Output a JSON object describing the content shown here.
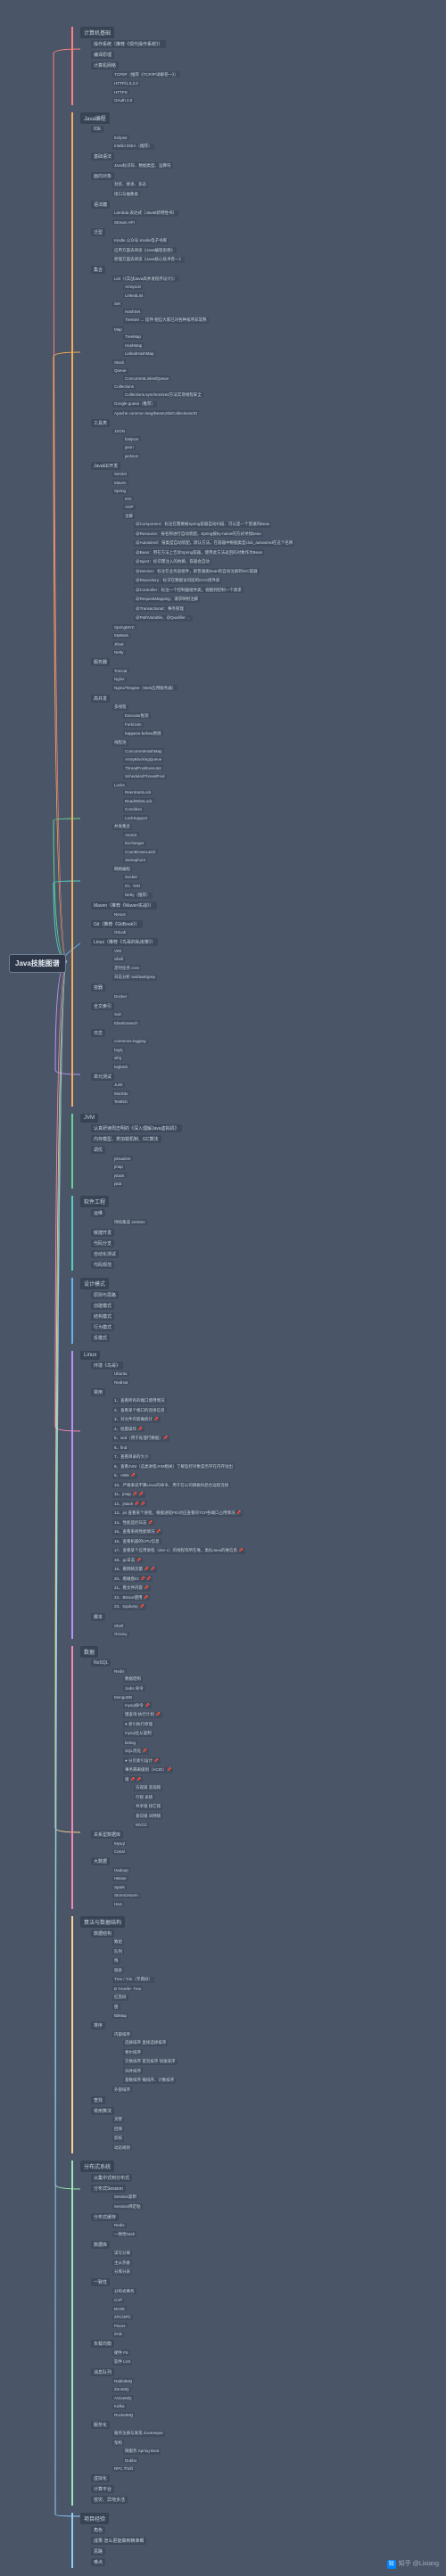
{
  "root": "Java技能图谱",
  "watermark": "知乎 @Lixiang",
  "branches": [
    {
      "title": "计算机基础",
      "color": "c1",
      "children": [
        {
          "label": "操作系统（推荐《现代操作系统》）"
        },
        {
          "label": "编译原理"
        },
        {
          "label": "计算机网络",
          "children": [
            {
              "label": "TCP/IP（推荐《TCP/IP详解卷一》）"
            },
            {
              "label": "HTTP/1.0,2.0"
            },
            {
              "label": "HTTPS"
            },
            {
              "label": "OAuth 2.0"
            }
          ]
        }
      ]
    },
    {
      "title": "Java编程",
      "color": "c2",
      "children": [
        {
          "label": "IDE",
          "children": [
            {
              "label": "Eclipse"
            },
            {
              "label": "IntelliJ IDEA（推荐）"
            }
          ]
        },
        {
          "label": "基础语法",
          "children": [
            {
              "label": "Java标识符、数据类型、运算符"
            }
          ]
        },
        {
          "label": "面向对象",
          "children": [
            {
              "label": "封装、继承、多态"
            },
            {
              "label": "接口与抽象类"
            }
          ]
        },
        {
          "label": "语法糖",
          "children": [
            {
              "label": "Lambda 表达式（Java8新特性书）"
            },
            {
              "label": "Stream API"
            }
          ]
        },
        {
          "label": "泛型",
          "children": [
            {
              "label": "Kindle 公众号 Kindle电子书库"
            },
            {
              "label": "应用方面去阅读《Java编程思想》"
            },
            {
              "label": "原理方面去阅读《Java核心技术卷一》"
            }
          ]
        },
        {
          "label": "集合",
          "children": [
            {
              "label": "List（《实战Java高并发程序设计》）",
              "children": [
                {
                  "label": "ArrayList"
                },
                {
                  "label": "LinkedList"
                }
              ]
            },
            {
              "label": "Set",
              "children": [
                {
                  "label": "HashSet"
                },
                {
                  "label": "TreeSet → 延伸 相信大家已对各种排序非常熟"
                }
              ]
            },
            {
              "label": "Map",
              "children": [
                {
                  "label": "TreeMap"
                },
                {
                  "label": "HashMap"
                },
                {
                  "label": "LinkedHashMap"
                }
              ]
            },
            {
              "label": "Stack"
            },
            {
              "label": "Queue",
              "children": [
                {
                  "label": "ConcurrentLinkedQueue"
                }
              ]
            },
            {
              "label": "Collections",
              "children": [
                {
                  "label": "Collections.synchronized方法实现线程安全"
                }
              ]
            },
            {
              "label": "Google guava（推荐）"
            },
            {
              "label": "Apache common lang/BeanUtils/Collections/IO"
            }
          ]
        },
        {
          "label": "工具类",
          "children": [
            {
              "label": "JSON",
              "children": [
                {
                  "label": "fastjson"
                },
                {
                  "label": "gson"
                },
                {
                  "label": "jackson"
                }
              ]
            }
          ]
        },
        {
          "label": "JavaEE开发",
          "children": [
            {
              "label": "Servlet"
            },
            {
              "label": "Maven"
            },
            {
              "label": "Spring",
              "children": [
                {
                  "label": "IOC"
                },
                {
                  "label": "AOP"
                },
                {
                  "label": "注解",
                  "children": [
                    {
                      "label": "@Component：标注在需要被Spring容器自动扫描、可以是一个普通的Bean"
                    },
                    {
                      "label": "@Resource：按名称进行自动装配，Spring按by-name的方式寻找bean"
                    },
                    {
                      "label": "@Autowired：按类型自动装配，默认方法，在容器中根据类型club_autowired在这个名称"
                    },
                    {
                      "label": "@Bean：用在方法上告诉Spring容器，使用此方法返回的对象作为Bean"
                    },
                    {
                      "label": "@Inject：标识需注入的依赖，容器会自动"
                    },
                    {
                      "label": "@Service：标注在业务层组件，即普通类bean的自动注册到IOC容器"
                    },
                    {
                      "label": "@Repository：标识在数据访问层的DAO组件类"
                    },
                    {
                      "label": "@Controller：标注一个控制器组件类，视图到控制一个请求"
                    },
                    {
                      "label": "@RequestMapping：请求映射注解"
                    },
                    {
                      "label": "@Transactional：事务管理"
                    },
                    {
                      "label": "@PathVariable、@Qualifier …"
                    }
                  ]
                }
              ]
            },
            {
              "label": "SpringMVC"
            },
            {
              "label": "MyBatis"
            },
            {
              "label": "Jfinal"
            },
            {
              "label": "Netty"
            }
          ]
        },
        {
          "label": "服务器",
          "children": [
            {
              "label": "Tomcat"
            },
            {
              "label": "Nginx"
            },
            {
              "label": "Nginx/Tengine（Web应用服务器）"
            }
          ]
        },
        {
          "label": "高并发",
          "children": [
            {
              "label": "多线程",
              "children": [
                {
                  "label": "Executor框架"
                },
                {
                  "label": "Fork/Join"
                },
                {
                  "label": "happens-before原则"
                }
              ]
            },
            {
              "label": "线程池",
              "children": [
                {
                  "label": "ConcurrentHashMap"
                },
                {
                  "label": "ArrayBlockingQueue"
                },
                {
                  "label": "ThreadPoolExecutor"
                },
                {
                  "label": "ScheduledThreadPool"
                }
              ]
            },
            {
              "label": "Locks",
              "children": [
                {
                  "label": "ReentrantLock"
                },
                {
                  "label": "ReadWriteLock"
                },
                {
                  "label": "Condition"
                },
                {
                  "label": "LockSupport"
                }
              ]
            },
            {
              "label": "并发集合",
              "children": [
                {
                  "label": "Atomic"
                },
                {
                  "label": "Exchanger"
                },
                {
                  "label": "CountDownLatch"
                },
                {
                  "label": "Semaphore"
                }
              ]
            },
            {
              "label": "网络编程",
              "children": [
                {
                  "label": "Socket"
                },
                {
                  "label": "IO、NIO"
                },
                {
                  "label": "Netty（推荐）"
                }
              ]
            }
          ]
        },
        {
          "label": "Maven（推荐《Maven实战》）",
          "children": [
            {
              "label": "Nexus"
            }
          ]
        },
        {
          "label": "Git（推荐《GitBook》）",
          "children": [
            {
              "label": "GitLab"
            }
          ]
        },
        {
          "label": "Linux（推荐《鸟哥的私房菜》）",
          "children": [
            {
              "label": "VIM"
            },
            {
              "label": "Shell"
            },
            {
              "label": "定时任务 cron"
            },
            {
              "label": "日志分析 sed/awk/grep"
            }
          ]
        },
        {
          "label": "容器",
          "children": [
            {
              "label": "Docker"
            }
          ]
        },
        {
          "label": "全文索引",
          "children": [
            {
              "label": "Solr"
            },
            {
              "label": "Elasticsearch"
            }
          ]
        },
        {
          "label": "日志",
          "children": [
            {
              "label": "commons-logging"
            },
            {
              "label": "log4j"
            },
            {
              "label": "slf4j"
            },
            {
              "label": "logback"
            }
          ]
        },
        {
          "label": "单元测试",
          "children": [
            {
              "label": "Junit"
            },
            {
              "label": "Mockito"
            },
            {
              "label": "TestNG"
            }
          ]
        }
      ]
    },
    {
      "title": "JVM",
      "color": "c3",
      "children": [
        {
          "label": "认真研读周志明的《深入理解Java虚拟机》"
        },
        {
          "label": "内存模型、类加载机制、GC算法"
        },
        {
          "label": "调优",
          "children": [
            {
              "label": "jvisualvm"
            },
            {
              "label": "jmap"
            },
            {
              "label": "jstack"
            },
            {
              "label": "jstat"
            }
          ]
        }
      ]
    },
    {
      "title": "软件工程",
      "color": "c4",
      "children": [
        {
          "label": "运维",
          "children": [
            {
              "label": "持续集成 Jenkins"
            }
          ]
        },
        {
          "label": "敏捷开发"
        },
        {
          "label": "代码分支"
        },
        {
          "label": "自动化测试"
        },
        {
          "label": "代码规范"
        }
      ]
    },
    {
      "title": "设计模式",
      "color": "c5",
      "children": [
        {
          "label": "原则与思路"
        },
        {
          "label": "创建模式"
        },
        {
          "label": "结构模式"
        },
        {
          "label": "行为模式"
        },
        {
          "label": "反模式"
        }
      ]
    },
    {
      "title": "Linux",
      "color": "c6",
      "children": [
        {
          "label": "环境《鸟哥》",
          "children": [
            {
              "label": "Ubuntu"
            },
            {
              "label": "RedHat"
            }
          ]
        },
        {
          "label": "常用",
          "children": [
            {
              "label": "1、查看所有的端口使用情况"
            },
            {
              "label": "2、查看某个端口的连接信息"
            },
            {
              "label": "3、对文件内容做统计 📌"
            },
            {
              "label": "4、批量操作 📌"
            },
            {
              "label": "5、sed（用于处理行数据）📌"
            },
            {
              "label": "6、find"
            },
            {
              "label": "7、查看目录的大小"
            },
            {
              "label": "8、查看JVM（这类进程JVM相关）了解监控对象是否存在内存溢出"
            },
            {
              "label": "9、AWK 📌"
            },
            {
              "label": "10、严格来说不算Linux的命令，用于在公司跳板机后台远程连接"
            },
            {
              "label": "11、jmap 📌 📌"
            },
            {
              "label": "12、jstack 📌 📌"
            },
            {
              "label": "13、ps 查看某个进程，根据进程PID对应查看的TCP各端口占用情况 📌"
            },
            {
              "label": "14、性能监控日志 📌"
            },
            {
              "label": "15、查看系统性能情况 📌"
            },
            {
              "label": "16、查看机器的CPU信息"
            },
            {
              "label": "17、查看某个应用进程（dev-c）的线程等所在堆，类似Java的堆信息 📌"
            },
            {
              "label": "18、gc日志 📌"
            },
            {
              "label": "19、看网络流量 📌 📌"
            },
            {
              "label": "20、看磁盘IO 📌 📌"
            },
            {
              "label": "21、看文件内容 📌"
            },
            {
              "label": "22、Btrace使用 📌"
            },
            {
              "label": "23、tcpdump 📌"
            }
          ]
        },
        {
          "label": "脚本",
          "children": [
            {
              "label": "Shell"
            },
            {
              "label": "Groovy"
            }
          ]
        }
      ]
    },
    {
      "title": "数据",
      "color": "c7",
      "children": [
        {
          "label": "NoSQL",
          "children": [
            {
              "label": "Redis",
              "children": [
                {
                  "label": "数据结构"
                },
                {
                  "label": "Jedis 命令"
                }
              ]
            },
            {
              "label": "MongoDB",
              "children": [
                {
                  "label": "mysql命令 📌"
                },
                {
                  "label": "慢查询 执行计划 📌"
                },
                {
                  "label": "● 索引执行原理"
                },
                {
                  "label": "mysql主从复制"
                },
                {
                  "label": "binlog"
                },
                {
                  "label": "SQL优化 📌"
                },
                {
                  "label": "● 分页索引设计 📌"
                },
                {
                  "label": "事务隔离级别（ACID）📌"
                },
                {
                  "label": "锁 📌 📌",
                  "children": [
                    {
                      "label": "乐观锁 悲观锁"
                    },
                    {
                      "label": "行锁 表锁"
                    },
                    {
                      "label": "共享锁 排它锁"
                    },
                    {
                      "label": "意向锁 间隙锁"
                    },
                    {
                      "label": "MVCC"
                    }
                  ]
                }
              ]
            }
          ]
        },
        {
          "label": "关系型数据库",
          "children": [
            {
              "label": "Mysql"
            },
            {
              "label": "Canal"
            }
          ]
        },
        {
          "label": "大数据",
          "children": [
            {
              "label": "Hadoop"
            },
            {
              "label": "HBase"
            },
            {
              "label": "Spark"
            },
            {
              "label": "Storm/Jstorm"
            },
            {
              "label": "Hive"
            }
          ]
        }
      ]
    },
    {
      "title": "算法与数据结构",
      "color": "c8",
      "children": [
        {
          "label": "数据结构",
          "children": [
            {
              "label": "数组"
            },
            {
              "label": "队列"
            },
            {
              "label": "栈"
            },
            {
              "label": "链表"
            },
            {
              "label": "Tree / Trie（字典树）"
            },
            {
              "label": "B Tree/B+ Tree"
            },
            {
              "label": "红黑树"
            },
            {
              "label": "图"
            },
            {
              "label": "BitMap"
            }
          ]
        },
        {
          "label": "排序",
          "children": [
            {
              "label": "内部排序",
              "children": [
                {
                  "label": "选择排序 直接选择排序"
                },
                {
                  "label": "希尔排序"
                },
                {
                  "label": "交换排序 冒泡排序 快速排序"
                },
                {
                  "label": "归并排序"
                },
                {
                  "label": "基数排序 桶排序、计数排序"
                }
              ]
            },
            {
              "label": "外部排序"
            }
          ]
        },
        {
          "label": "查找"
        },
        {
          "label": "常用算法",
          "children": [
            {
              "label": "贪婪"
            },
            {
              "label": "回溯"
            },
            {
              "label": "剪枝"
            },
            {
              "label": "动态规划"
            }
          ]
        }
      ]
    },
    {
      "title": "分布式系统",
      "color": "c9",
      "children": [
        {
          "label": "从集中式到分布式"
        },
        {
          "label": "分布式Session",
          "children": [
            {
              "label": "Session复制"
            },
            {
              "label": "Session绑定粘"
            }
          ]
        },
        {
          "label": "分布式缓存",
          "children": [
            {
              "label": "Redis"
            },
            {
              "label": "一致性hash"
            }
          ]
        },
        {
          "label": "数据库",
          "children": [
            {
              "label": "读写分离"
            },
            {
              "label": "主从热备"
            },
            {
              "label": "分库分表"
            }
          ]
        },
        {
          "label": "一致性",
          "children": [
            {
              "label": "分布式事务"
            },
            {
              "label": "CAP"
            },
            {
              "label": "BASE"
            },
            {
              "label": "2PC/3PC"
            },
            {
              "label": "Paxos"
            },
            {
              "label": "ZAB"
            }
          ]
        },
        {
          "label": "负载均衡",
          "children": [
            {
              "label": "硬件 F5"
            },
            {
              "label": "软件 LVS"
            }
          ]
        },
        {
          "label": "消息队列",
          "children": [
            {
              "label": "RabbitMQ"
            },
            {
              "label": "ZeroMQ"
            },
            {
              "label": "ActiveMQ"
            },
            {
              "label": "Kafka"
            },
            {
              "label": "RocketMQ"
            }
          ]
        },
        {
          "label": "服务化",
          "children": [
            {
              "label": "服务注册与发现 ZooKeeper"
            },
            {
              "label": "架构",
              "children": [
                {
                  "label": "微服务 Spring Boot"
                },
                {
                  "label": "Dubbo"
                }
              ]
            },
            {
              "label": "RPC Thrift"
            }
          ]
        },
        {
          "label": "虚拟化"
        },
        {
          "label": "计算平台"
        },
        {
          "label": "容灾、异地多活"
        }
      ]
    },
    {
      "title": "项目经验",
      "color": "c10",
      "children": [
        {
          "label": "角色"
        },
        {
          "label": "成果 怎么更能做到精准细"
        },
        {
          "label": "思路"
        },
        {
          "label": "难点"
        }
      ]
    }
  ]
}
